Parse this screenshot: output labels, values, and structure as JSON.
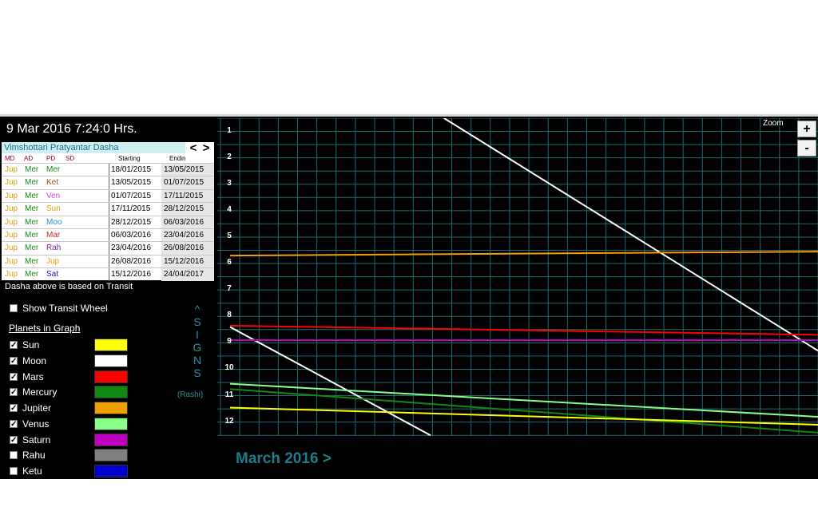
{
  "header": {
    "datetime": "9 Mar 2016  7:24:0 Hrs."
  },
  "dasha": {
    "title": "Vimshottari Pratyantar Dasha",
    "prev": "<",
    "next": ">",
    "columns": {
      "md": "MD",
      "ad": "AD",
      "pd": "PD",
      "sd": "SD",
      "start": "Starting",
      "end": "Endin"
    },
    "rows": [
      {
        "md": "Jup",
        "ad": "Mer",
        "pd": "Mer",
        "start": "18/01/2015",
        "end": "13/05/2015"
      },
      {
        "md": "Jup",
        "ad": "Mer",
        "pd": "Ket",
        "start": "13/05/2015",
        "end": "01/07/2015"
      },
      {
        "md": "Jup",
        "ad": "Mer",
        "pd": "Ven",
        "start": "01/07/2015",
        "end": "17/11/2015"
      },
      {
        "md": "Jup",
        "ad": "Mer",
        "pd": "Sun",
        "start": "17/11/2015",
        "end": "28/12/2015"
      },
      {
        "md": "Jup",
        "ad": "Mer",
        "pd": "Moo",
        "start": "28/12/2015",
        "end": "06/03/2016"
      },
      {
        "md": "Jup",
        "ad": "Mer",
        "pd": "Mar",
        "start": "06/03/2016",
        "end": "23/04/2016"
      },
      {
        "md": "Jup",
        "ad": "Mer",
        "pd": "Rah",
        "start": "23/04/2016",
        "end": "26/08/2016"
      },
      {
        "md": "Jup",
        "ad": "Mer",
        "pd": "Jup",
        "start": "26/08/2016",
        "end": "15/12/2016"
      },
      {
        "md": "Jup",
        "ad": "Mer",
        "pd": "Sat",
        "start": "15/12/2016",
        "end": "24/04/2017"
      }
    ],
    "note": "Dasha above is based on Transit"
  },
  "lord_colors": {
    "Jup": "#e8a000",
    "Mer": "#1a8a1a",
    "Ket": "#8b5a2b",
    "Ven": "#d040d0",
    "Sun": "#d4a000",
    "Moo": "#3090e0",
    "Mar": "#e02020",
    "Rah": "#7a2aa0",
    "Sat": "#2020c0"
  },
  "options": {
    "transit_wheel_label": "Show Transit Wheel",
    "transit_wheel_checked": false
  },
  "planets_heading": "Planets in Graph",
  "planets": [
    {
      "name": "Sun",
      "checked": true,
      "color": "#ffff00"
    },
    {
      "name": "Moon",
      "checked": true,
      "color": "#ffffff"
    },
    {
      "name": "Mars",
      "checked": true,
      "color": "#ff0000"
    },
    {
      "name": "Mercury",
      "checked": true,
      "color": "#118811"
    },
    {
      "name": "Jupiter",
      "checked": true,
      "color": "#f0a000"
    },
    {
      "name": "Venus",
      "checked": true,
      "color": "#88ff88"
    },
    {
      "name": "Saturn",
      "checked": true,
      "color": "#c000c0"
    },
    {
      "name": "Rahu",
      "checked": false,
      "color": "#808080"
    },
    {
      "name": "Ketu",
      "checked": false,
      "color": "#0000cc"
    }
  ],
  "signs_axis": {
    "arrow": "^",
    "letters": [
      "S",
      "I",
      "G",
      "N",
      "S"
    ],
    "sub": "(Rashi)"
  },
  "zoom": {
    "label": "Zoom",
    "plus": "+",
    "minus": "-"
  },
  "month_label": "March 2016 >",
  "chart_data": {
    "type": "line",
    "x": [
      1,
      31
    ],
    "xlim": [
      1,
      31
    ],
    "x_ticks": [
      1,
      2,
      3,
      4,
      5,
      6,
      7,
      8,
      9,
      10,
      11,
      12,
      13,
      14,
      15,
      16,
      17,
      18,
      19,
      20,
      21,
      22,
      23,
      24,
      25,
      26,
      27,
      28,
      29,
      30,
      31
    ],
    "y_ticks": [
      1,
      2,
      3,
      4,
      5,
      6,
      7,
      8,
      9,
      10,
      11,
      12
    ],
    "ylim": [
      0.5,
      12.5
    ],
    "grid": true,
    "series": [
      {
        "planet": "Moon",
        "segments": [
          [
            [
              12.1,
              0.5
            ],
            [
              31.5,
              9.3
            ]
          ],
          [
            [
              1,
              8.4
            ],
            [
              11.4,
              12.5
            ]
          ]
        ]
      },
      {
        "planet": "Jupiter",
        "segments": [
          [
            [
              1,
              5.7
            ],
            [
              31.5,
              5.55
            ]
          ]
        ]
      },
      {
        "planet": "Mars",
        "segments": [
          [
            [
              1,
              8.35
            ],
            [
              31.5,
              8.7
            ]
          ]
        ]
      },
      {
        "planet": "Saturn",
        "segments": [
          [
            [
              1,
              8.9
            ],
            [
              31.5,
              8.9
            ]
          ]
        ]
      },
      {
        "planet": "Venus",
        "segments": [
          [
            [
              1,
              10.55
            ],
            [
              31.5,
              11.8
            ]
          ]
        ]
      },
      {
        "planet": "Mercury",
        "segments": [
          [
            [
              1,
              10.75
            ],
            [
              31.5,
              12.4
            ]
          ]
        ]
      },
      {
        "planet": "Sun",
        "segments": [
          [
            [
              1,
              11.45
            ],
            [
              31.5,
              12.1
            ]
          ]
        ]
      }
    ]
  }
}
